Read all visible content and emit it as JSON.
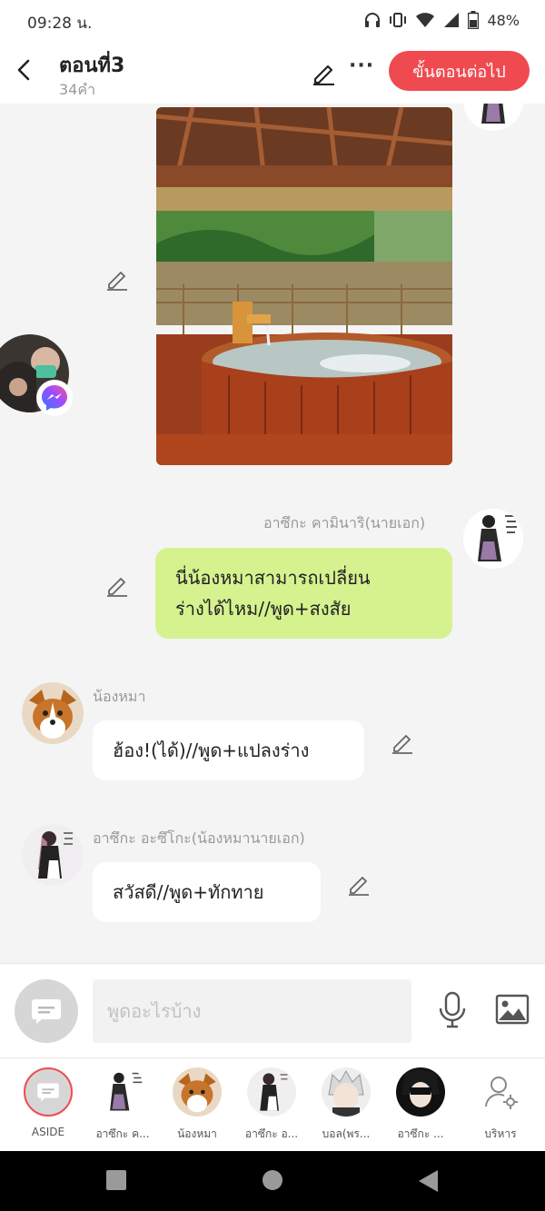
{
  "status_bar": {
    "time": "09:28 น.",
    "battery": "48%",
    "icons": [
      "headphones-icon",
      "vibrate-icon",
      "wifi-icon",
      "signal-icon",
      "battery-icon"
    ]
  },
  "header": {
    "title": "ตอนที่3",
    "word_count": "34คำ",
    "next_button": "ขั้นตอนต่อไป",
    "more": "···"
  },
  "messages": [
    {
      "type": "image",
      "side": "right",
      "description": "outdoor wooden hot tub"
    },
    {
      "type": "text",
      "side": "right",
      "sender": "อาซึกะ คามินาริ(นายเอก)",
      "text_line1": "นี่น้องหมาสามารถเปลี่ยน",
      "text_line2": "ร่างได้ไหม//พูด+สงสัย"
    },
    {
      "type": "text",
      "side": "left",
      "sender": "น้องหมา",
      "text": "ฮ้อง!(ได้)//พูด+แปลงร่าง"
    },
    {
      "type": "text",
      "side": "left",
      "sender": "อาซึกะ อะซึโกะ(น้องหมานายเอก)",
      "text": "สวัสดี//พูด+ทักทาย"
    }
  ],
  "input": {
    "placeholder": "พูดอะไรบ้าง"
  },
  "characters": [
    {
      "label": "ASIDE"
    },
    {
      "label": "อาซึกะ ค..."
    },
    {
      "label": "น้องหมา"
    },
    {
      "label": "อาซึกะ อ..."
    },
    {
      "label": "บอล(พร..."
    },
    {
      "label": "อาซึกะ ..."
    },
    {
      "label": "บริหาร"
    }
  ],
  "colors": {
    "accent": "#ef4a50",
    "right_bubble": "#d5f28f",
    "left_bubble": "#ffffff",
    "background": "#f4f4f4"
  }
}
